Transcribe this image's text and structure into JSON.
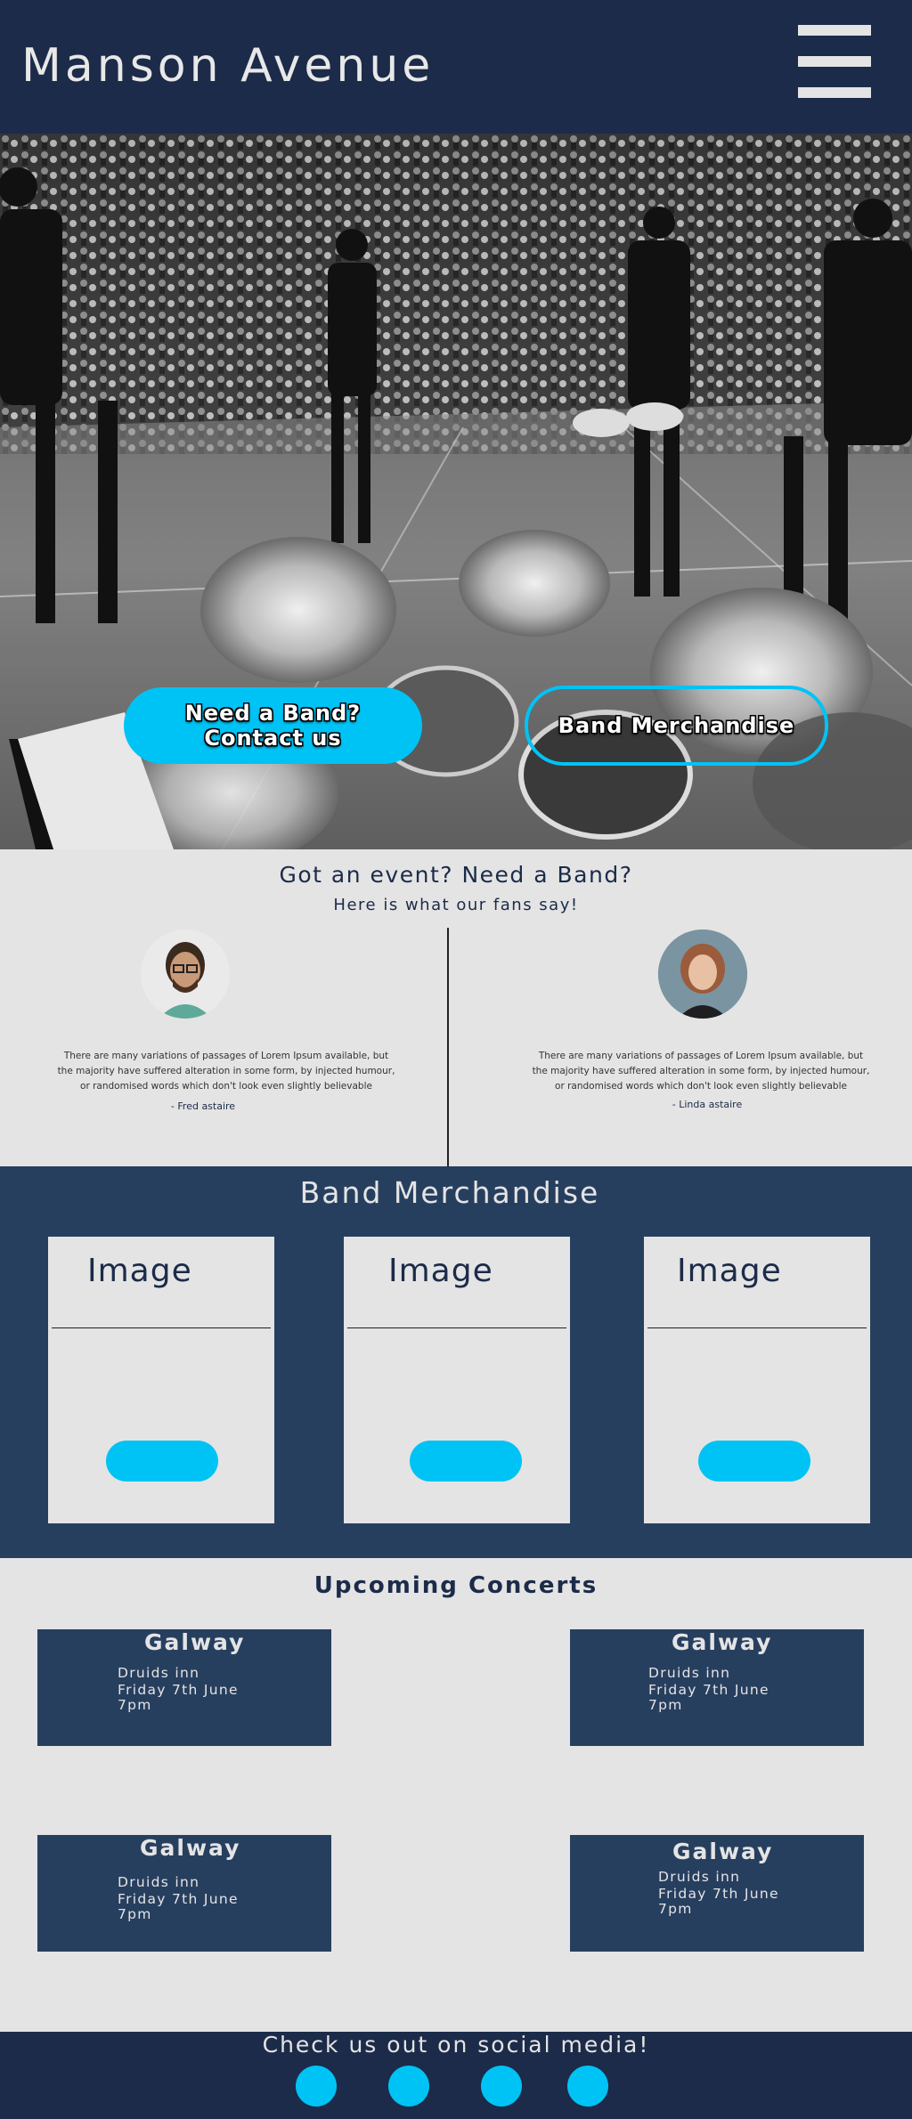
{
  "header": {
    "brand": "Manson Avenue"
  },
  "hero": {
    "contact_button": "Need a Band?\nContact us",
    "merch_button": "Band Merchandise"
  },
  "testimonials": {
    "title": "Got an event? Need a Band?",
    "subtitle": "Here is what our fans say!",
    "items": [
      {
        "quote": "There are many variations of passages of Lorem Ipsum available, but the majority have suffered alteration in some form, by injected humour, or randomised words which don't look even slightly believable",
        "author": "- Fred astaire"
      },
      {
        "quote": "There are many variations of passages of Lorem Ipsum available, but the majority have suffered alteration in some form, by injected humour, or randomised words which don't look even slightly believable",
        "author": "- Linda astaire"
      }
    ]
  },
  "merch": {
    "title": "Band Merchandise",
    "cards": [
      {
        "label": "Image"
      },
      {
        "label": "Image"
      },
      {
        "label": "Image"
      }
    ]
  },
  "concerts": {
    "title": "Upcoming Concerts",
    "items": [
      {
        "city": "Galway",
        "venue": "Druids inn",
        "date": "Friday 7th June",
        "time": "7pm"
      },
      {
        "city": "Galway",
        "venue": "Druids inn",
        "date": "Friday 7th June",
        "time": "7pm"
      },
      {
        "city": "Galway",
        "venue": "Druids inn",
        "date": "Friday 7th June",
        "time": "7pm"
      },
      {
        "city": "Galway",
        "venue": "Druids inn",
        "date": "Friday 7th June",
        "time": "7pm"
      }
    ]
  },
  "footer": {
    "title": "Check us out on social media!"
  },
  "colors": {
    "navy": "#1c2b49",
    "panel": "#273f5f",
    "accent": "#00c3f5",
    "background": "#e4e4e4"
  }
}
